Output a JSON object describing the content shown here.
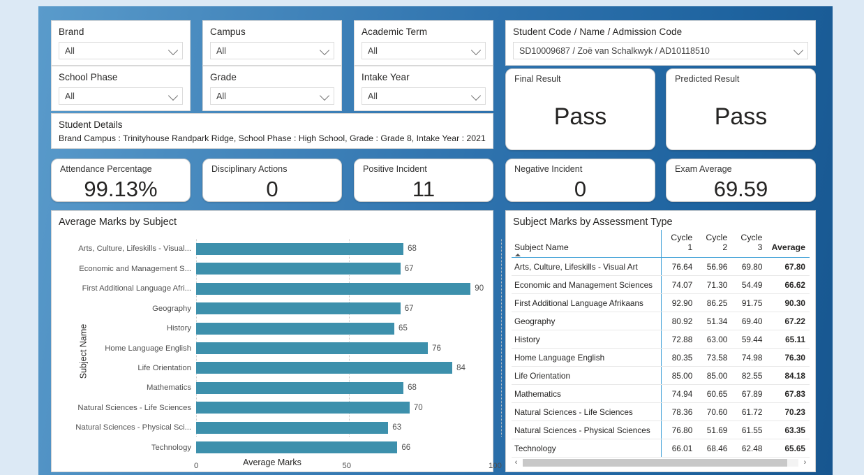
{
  "theme": {
    "page_bg": "#dce9f5",
    "canvas_gradient_from": "#5a9bcb",
    "canvas_gradient_to": "#17568f",
    "bar_color": "#3d90ac",
    "table_accent": "#3b9ed6"
  },
  "slicers": [
    {
      "label": "Brand",
      "value": "All",
      "icon": "chevron-down-icon"
    },
    {
      "label": "Campus",
      "value": "All",
      "icon": "chevron-down-icon"
    },
    {
      "label": "Academic Term",
      "value": "All",
      "icon": "chevron-down-icon"
    },
    {
      "label": "School Phase",
      "value": "All",
      "icon": "chevron-down-icon"
    },
    {
      "label": "Grade",
      "value": "All",
      "icon": "chevron-down-icon"
    },
    {
      "label": "Intake Year",
      "value": "All",
      "icon": "chevron-down-icon"
    }
  ],
  "student_slicer": {
    "label": "Student Code / Name / Admission Code",
    "value": "SD10009687 / Zoë van Schalkwyk / AD10118510",
    "icon": "chevron-down-icon"
  },
  "student_details": {
    "title": "Student Details",
    "text": "Brand Campus : Trinityhouse Randpark Ridge, School Phase : High School, Grade : Grade 8, Intake Year : 2021"
  },
  "results": [
    {
      "label": "Final Result",
      "value": "Pass"
    },
    {
      "label": "Predicted Result",
      "value": "Pass"
    }
  ],
  "kpis": [
    {
      "label": "Attendance Percentage",
      "value": "99.13%"
    },
    {
      "label": "Disciplinary Actions",
      "value": "0"
    },
    {
      "label": "Positive Incident",
      "value": "11"
    },
    {
      "label": "Negative Incident",
      "value": "0"
    },
    {
      "label": "Exam Average",
      "value": "69.59"
    }
  ],
  "chart_data": {
    "type": "bar",
    "title": "Average Marks by Subject",
    "orientation": "horizontal",
    "xlabel": "Average Marks",
    "ylabel": "Subject Name",
    "xlim": [
      0,
      100
    ],
    "xticks": [
      "0",
      "50",
      "100"
    ],
    "grid": true,
    "legend": "none",
    "categories": [
      "Arts, Culture, Lifeskills - Visual...",
      "Economic and Management S...",
      "First Additional Language Afri...",
      "Geography",
      "History",
      "Home Language English",
      "Life Orientation",
      "Mathematics",
      "Natural Sciences - Life Sciences",
      "Natural Sciences - Physical Sci...",
      "Technology"
    ],
    "values": [
      68,
      67,
      90,
      67,
      65,
      76,
      84,
      68,
      70,
      63,
      66
    ],
    "labels": [
      "68",
      "67",
      "90",
      "67",
      "65",
      "76",
      "84",
      "68",
      "70",
      "63",
      "66"
    ]
  },
  "table": {
    "title": "Subject Marks by Assessment Type",
    "sorted_by": "Subject Name",
    "sort_direction": "ascending",
    "columns": [
      "Subject Name",
      "Cycle 1",
      "Cycle 2",
      "Cycle 3",
      "Average"
    ],
    "rows": [
      {
        "subject": "Arts, Culture, Lifeskills - Visual Art",
        "c1": "76.64",
        "c2": "56.96",
        "c3": "69.80",
        "avg": "67.80"
      },
      {
        "subject": "Economic and Management Sciences",
        "c1": "74.07",
        "c2": "71.30",
        "c3": "54.49",
        "avg": "66.62"
      },
      {
        "subject": "First Additional Language Afrikaans",
        "c1": "92.90",
        "c2": "86.25",
        "c3": "91.75",
        "avg": "90.30"
      },
      {
        "subject": "Geography",
        "c1": "80.92",
        "c2": "51.34",
        "c3": "69.40",
        "avg": "67.22"
      },
      {
        "subject": "History",
        "c1": "72.88",
        "c2": "63.00",
        "c3": "59.44",
        "avg": "65.11"
      },
      {
        "subject": "Home Language English",
        "c1": "80.35",
        "c2": "73.58",
        "c3": "74.98",
        "avg": "76.30"
      },
      {
        "subject": "Life Orientation",
        "c1": "85.00",
        "c2": "85.00",
        "c3": "82.55",
        "avg": "84.18"
      },
      {
        "subject": "Mathematics",
        "c1": "74.94",
        "c2": "60.65",
        "c3": "67.89",
        "avg": "67.83"
      },
      {
        "subject": "Natural Sciences - Life Sciences",
        "c1": "78.36",
        "c2": "70.60",
        "c3": "61.72",
        "avg": "70.23"
      },
      {
        "subject": "Natural Sciences - Physical Sciences",
        "c1": "76.80",
        "c2": "51.69",
        "c3": "61.55",
        "avg": "63.35"
      },
      {
        "subject": "Technology",
        "c1": "66.01",
        "c2": "68.46",
        "c3": "62.48",
        "avg": "65.65"
      }
    ],
    "scroll_left_icon": "chevron-left-icon",
    "scroll_right_icon": "chevron-right-icon"
  }
}
